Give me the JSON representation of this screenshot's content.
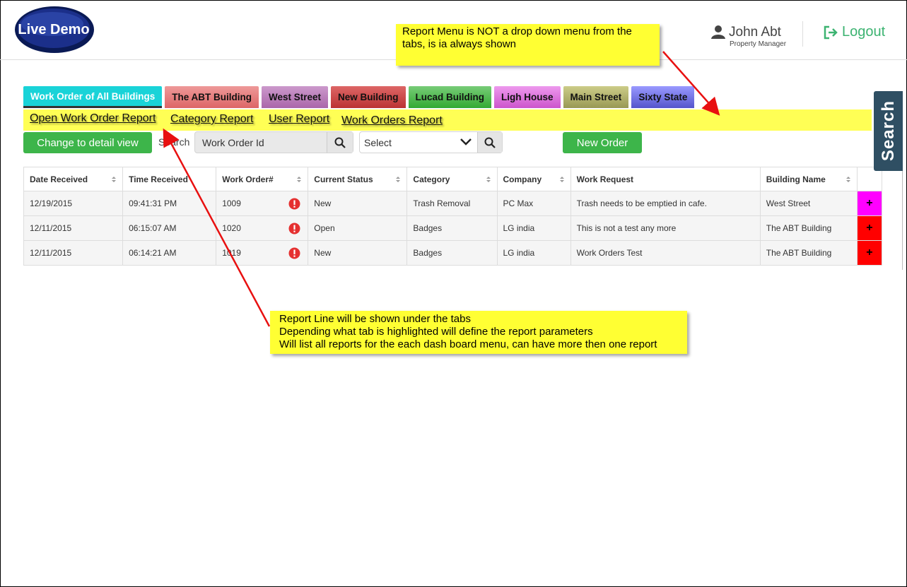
{
  "header": {
    "logo_text": "Live Demo",
    "user_name": "John Abt",
    "user_role": "Property Manager",
    "logout_label": "Logout"
  },
  "tabs": [
    {
      "label": "Work Order of All Buildings",
      "color": "#19d3d8",
      "active": true
    },
    {
      "label": "The ABT Building",
      "color": "#e07b7b"
    },
    {
      "label": "West Street",
      "color": "#b07bb0"
    },
    {
      "label": "New Building",
      "color": "#c94c4c"
    },
    {
      "label": "Lucad Building",
      "color": "#4caf50"
    },
    {
      "label": "Ligh House",
      "color": "#d67ad6"
    },
    {
      "label": "Main Street",
      "color": "#a8a25a"
    },
    {
      "label": "Sixty State",
      "color": "#6a6ad8"
    }
  ],
  "reports": [
    "Open Work Order Report",
    "Category  Report",
    "User Report",
    "Work Orders Report"
  ],
  "toolbar": {
    "detail_view_label": "Change to detail view",
    "search_label": "Search",
    "search_value": "Work Order Id",
    "select_value": "Select",
    "new_order_label": "New Order"
  },
  "table": {
    "headers": [
      "Date Received",
      "Time Received",
      "Work Order#",
      "Current Status",
      "Category",
      "Company",
      "Work Request",
      "Building Name"
    ],
    "rows": [
      {
        "date": "12/19/2015",
        "time": "09:41:31 PM",
        "order": "1009",
        "status": "New",
        "category": "Trash Removal",
        "company": "PC Max",
        "request": "Trash needs to be emptied in cafe.",
        "building": "West Street",
        "action": "+",
        "action_color": "#ff00ff"
      },
      {
        "date": "12/11/2015",
        "time": "06:15:07 AM",
        "order": "1020",
        "status": "Open",
        "category": "Badges",
        "company": "LG india",
        "request": "This is not a test any more",
        "building": "The ABT Building",
        "action": "+",
        "action_color": "#ff0000"
      },
      {
        "date": "12/11/2015",
        "time": "06:14:21 AM",
        "order": "1019",
        "status": "New",
        "category": "Badges",
        "company": "LG india",
        "request": "Work Orders Test",
        "building": "The ABT Building",
        "action": "+",
        "action_color": "#ff0000"
      }
    ]
  },
  "side_search_label": "Search",
  "notes": {
    "report_menu": "Report Menu is NOT a drop down menu from the tabs, is ia always shown",
    "report_line_1": "Report Line will be shown under the tabs",
    "report_line_2": "Depending what tab is highlighted will define the report parameters",
    "report_line_3": "Will list all reports for the each dash board menu, can have more then one report"
  }
}
